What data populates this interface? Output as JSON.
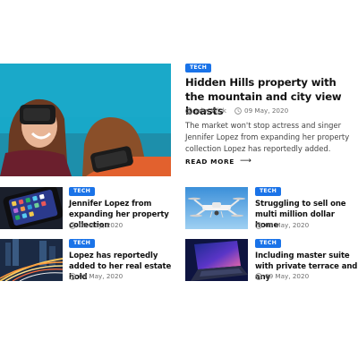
{
  "featured": {
    "tag": "TECH",
    "title": "Hidden Hills property with the mountain and city view boasts",
    "author": "John Wick",
    "date": "09 May, 2020",
    "excerpt": "The market won't stop actress and singer Jennifer Lopez from expanding her property collection Lopez has reportedly added.",
    "read_more": "READ MORE",
    "read_more_icon": "arrow-right-icon",
    "image": "two people wearing VR headsets"
  },
  "cards": [
    {
      "tag": "TECH",
      "title": "Jennifer Lopez from expanding her property collection",
      "date": "09 May, 2020",
      "image": "smartphone home screen"
    },
    {
      "tag": "TECH",
      "title": "Struggling to sell one multi million dollar home",
      "date": "09 May, 2020",
      "image": "white drone on blue sky"
    },
    {
      "tag": "TECH",
      "title": "Lopez has reportedly added to her real estate hold",
      "date": "09 May, 2020",
      "image": "city traffic light trails at night"
    },
    {
      "tag": "TECH",
      "title": "Including master suite with private terrace and any",
      "date": "09 May, 2020",
      "image": "laptop with colorful light"
    }
  ],
  "icons": {
    "author": "user-icon",
    "date": "clock-icon"
  },
  "colors": {
    "tag": "#1a73e8",
    "title": "#111111",
    "meta": "#6e6e6e"
  }
}
